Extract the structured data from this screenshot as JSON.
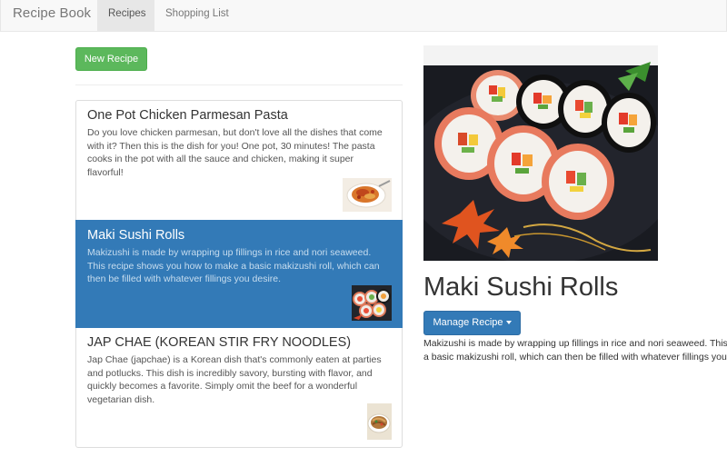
{
  "navbar": {
    "brand": "Recipe Book",
    "tabs": [
      {
        "label": "Recipes",
        "active": true
      },
      {
        "label": "Shopping List",
        "active": false
      }
    ]
  },
  "toolbar": {
    "new_recipe_label": "New Recipe"
  },
  "recipes": [
    {
      "title": "One Pot Chicken Parmesan Pasta",
      "description": "Do you love chicken parmesan, but don't love all the dishes that come with it? Then this is the dish for you! One pot, 30 minutes! The pasta cooks in the pot with all the sauce and chicken, making it super flavorful!",
      "selected": false,
      "thumbnail": "pasta-dish"
    },
    {
      "title": "Maki Sushi Rolls",
      "description": "Makizushi is made by wrapping up fillings in rice and nori seaweed. This recipe shows you how to make a basic makizushi roll, which can then be filled with whatever fillings you desire.",
      "selected": true,
      "thumbnail": "sushi-rolls"
    },
    {
      "title": "JAP CHAE (KOREAN STIR FRY NOODLES)",
      "description": "Jap Chae (japchae) is a Korean dish that's commonly eaten at parties and potlucks. This dish is incredibly savory, bursting with flavor, and quickly becomes a favorite. Simply omit the beef for a wonderful vegetarian dish.",
      "selected": false,
      "thumbnail": "noodle-dish"
    }
  ],
  "detail": {
    "title": "Maki Sushi Rolls",
    "manage_label": "Manage Recipe",
    "description_line1": "Makizushi is made by wrapping up fillings in rice and nori seaweed. This recipe shows you how to make",
    "description_line2": "a basic makizushi roll, which can then be filled with whatever fillings you desire.",
    "image": "sushi-rolls"
  },
  "colors": {
    "primary": "#337ab7",
    "success": "#5cb85c",
    "navbar_bg": "#f8f8f8"
  }
}
